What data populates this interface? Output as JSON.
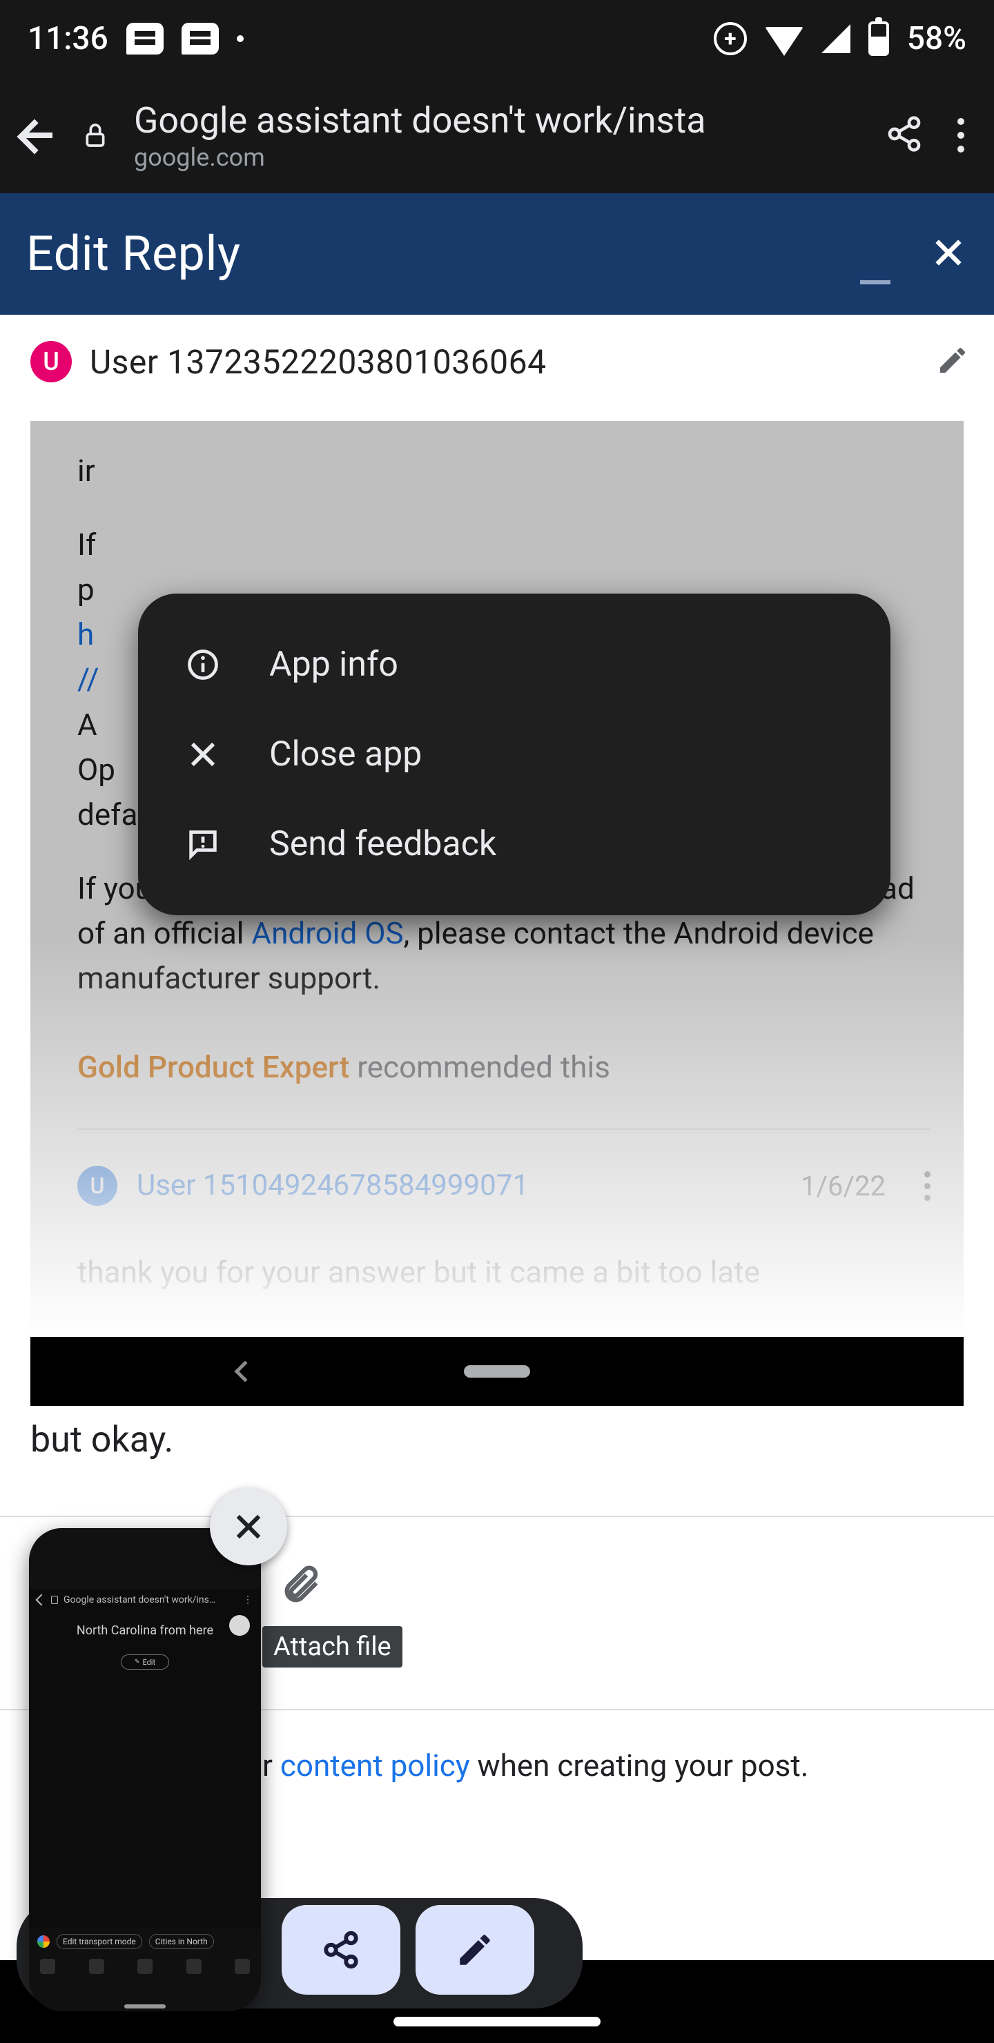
{
  "statusbar": {
    "time": "11:36",
    "battery": "58%"
  },
  "browser": {
    "title": "Google assistant doesn't work/insta",
    "domain": "google.com"
  },
  "edit_reply": {
    "title": "Edit Reply"
  },
  "author": {
    "initial": "U",
    "name": "User 13723522203801036064"
  },
  "popup": {
    "app_info": "App info",
    "close_app": "Close app",
    "send_feedback": "Send feedback"
  },
  "quoted": {
    "partial_top": "ir",
    "line_if": "If",
    "line_p": "p",
    "link_h": "h",
    "link_slash": "//",
    "line_A": "A",
    "line_Op": "Op",
    "line_default_tail": "default > disable by default",
    "para2_a": "If your device uses a third-party OS (operating system) instead of an official ",
    "para2_link": "Android OS",
    "para2_b": ", please contact the Android device manufacturer support.",
    "gpe": "Gold Product Expert",
    "recommended": " recommended this",
    "reply_user_initial": "U",
    "reply_user": "User 15104924678584999071",
    "reply_date": "1/6/22",
    "cut_line": "thank you for your answer but it came a bit too late"
  },
  "after_quote": "but okay.",
  "compose": {
    "attach_label": "Attach file",
    "policy_a": "r ",
    "policy_link": "content policy",
    "policy_b": " when creating your post."
  },
  "thumb": {
    "title": "Google assistant doesn't work/ins…",
    "sub": "North Carolina from here",
    "pill": "Edit",
    "chip1": "Edit transport mode",
    "chip2": "Cities in North"
  }
}
